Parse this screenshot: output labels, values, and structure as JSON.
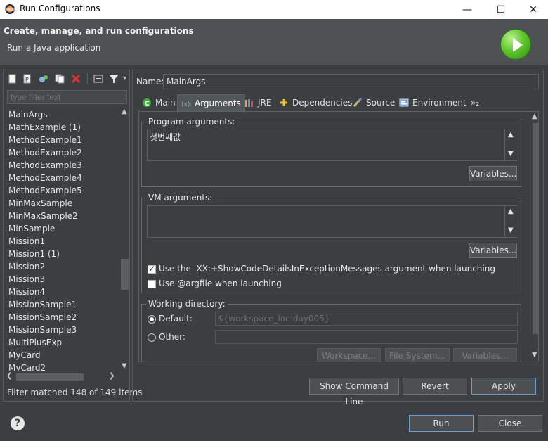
{
  "window": {
    "title": "Run Configurations",
    "minimize_glyph": "—",
    "maximize_glyph": "☐",
    "close_glyph": "✕"
  },
  "header": {
    "title": "Create, manage, and run configurations",
    "subtitle": "Run a Java application",
    "icon": "run-icon"
  },
  "left": {
    "filter_placeholder": "type filter text",
    "items": [
      "MainArgs",
      "MathExample (1)",
      "MethodExample1",
      "MethodExample2",
      "MethodExample3",
      "MethodExample4",
      "MethodExample5",
      "MinMaxSample",
      "MinMaxSample2",
      "MinSample",
      "Mission1",
      "Mission1 (1)",
      "Mission2",
      "Mission3",
      "Mission4",
      "MissionSample1",
      "MissionSample2",
      "MissionSample3",
      "MultiPlusExp",
      "MyCard",
      "MyCard2"
    ],
    "status": "Filter matched 148 of 149 items",
    "arrows": {
      "up": "▲",
      "down": "▼",
      "left": "❮",
      "right": "❯"
    }
  },
  "right": {
    "name_label": "Name:",
    "name_value": "MainArgs",
    "tabs": [
      "Main",
      "Arguments",
      "JRE",
      "Dependencies",
      "Source",
      "Environment",
      "»₂"
    ],
    "active_tab": "Arguments",
    "program_args": {
      "title": "Program arguments:",
      "value": "첫번째값",
      "variables_button": "Variables..."
    },
    "vm_args": {
      "title": "VM arguments:",
      "value": "",
      "variables_button": "Variables..."
    },
    "options": {
      "show_code_details": "Use the -XX:+ShowCodeDetailsInExceptionMessages argument when launching",
      "show_code_details_checked": true,
      "argfile": "Use @argfile when launching",
      "argfile_checked": false
    },
    "working_dir": {
      "title": "Working directory:",
      "default_label": "Default:",
      "default_value": "${workspace_loc:day005}",
      "other_label": "Other:",
      "other_value": "",
      "workspace_button": "Workspace...",
      "filesystem_button": "File System...",
      "variables_button": "Variables..."
    },
    "show_cmd_button": "Show Command Line",
    "revert_button": "Revert",
    "apply_button": "Apply"
  },
  "bottom": {
    "help": "?",
    "run_button": "Run",
    "close_button": "Close"
  },
  "colors": {
    "background": "#3c3f41",
    "banner": "#4f5254",
    "accent_border": "#6b9bd2",
    "run_green": "#5fc62c"
  }
}
